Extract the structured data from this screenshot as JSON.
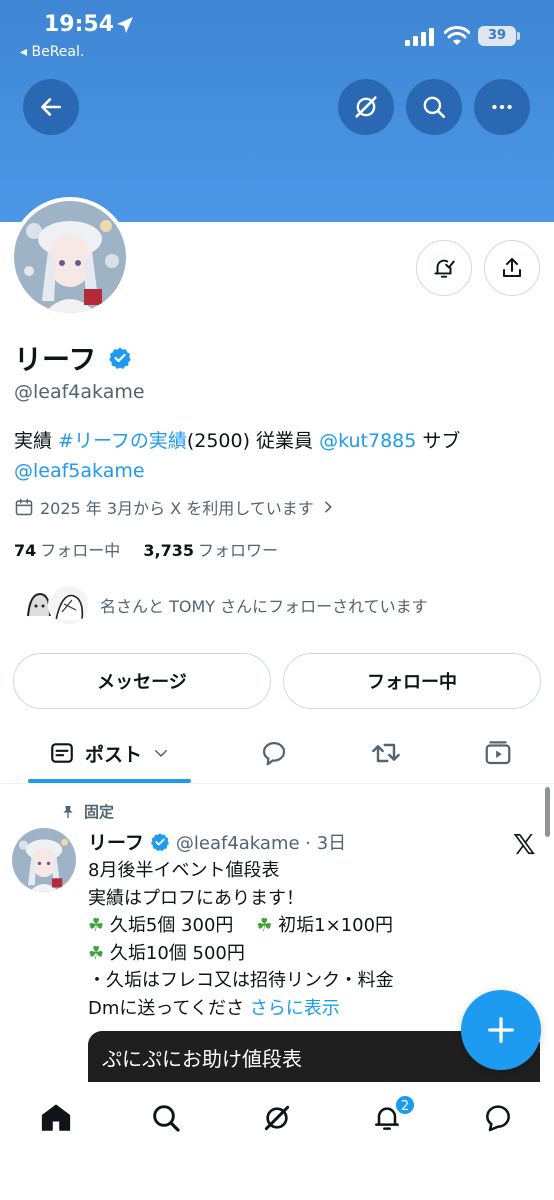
{
  "status": {
    "time": "19:54",
    "back_app": "◂ BeReal.",
    "battery": "39"
  },
  "profile": {
    "name": "リーフ",
    "handle": "@leaf4akame",
    "bio": {
      "t1": "実績 ",
      "hashtag": "#リーフの実績",
      "t2": "(2500) 従業員 ",
      "mention1": "@kut7885",
      "t3": " サブ",
      "mention2": "@leaf5akame"
    },
    "joined": "2025 年 3月から X を利用しています",
    "following_count": "74",
    "following_label": "フォロー中",
    "followers_count": "3,735",
    "followers_label": "フォロワー",
    "followed_by": "名さんと TOMY さんにフォローされています"
  },
  "actions": {
    "message": "メッセージ",
    "following": "フォロー中"
  },
  "tabs": {
    "posts": "ポスト"
  },
  "post": {
    "pinned": "固定",
    "name": "リーフ",
    "meta": "@leaf4akame · 3日",
    "lines": {
      "l1": "8月後半イベント値段表",
      "l2": "実績はプロフにあります！",
      "l3a": "久垢5個 300円",
      "l3b": "初垢1×100円",
      "l4": "久垢10個 500円",
      "l5": "・久垢はフレコ又は招待リンク・料金",
      "l6": "Dmに送ってくださ",
      "more": "さらに表示"
    },
    "card_text": "ぷにぷにお助け値段表"
  },
  "notifications_badge": "2",
  "colors": {
    "accent": "#1d9bf0",
    "banner": "#4b97e6",
    "clover": "#3fa33a"
  }
}
